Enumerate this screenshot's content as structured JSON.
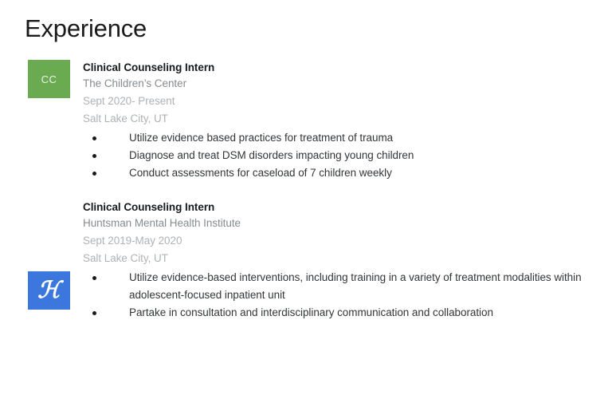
{
  "section": {
    "title": "Experience"
  },
  "colors": {
    "logo_green": "#6aab52",
    "logo_blue": "#3b77dd",
    "heading": "#1a1a1a",
    "job_title": "#16191d",
    "org_gray": "#868b8f",
    "meta_gray": "#aeb2b6",
    "bullet_text": "#333638",
    "background": "#ffffff"
  },
  "entries": [
    {
      "logo": {
        "type": "initials-badge",
        "icon_name": "childrens-center-logo",
        "text": "CC",
        "color": "#6aab52"
      },
      "title": "Clinical Counseling Intern",
      "organization": "The Children’s Center",
      "dates": "Sept 2020- Present",
      "location": "Salt Lake City, UT",
      "bullets": [
        "Utilize evidence based practices for treatment of trauma",
        "Diagnose and treat DSM disorders impacting young children",
        "Conduct assessments for caseload of 7 children weekly"
      ]
    },
    {
      "logo": {
        "type": "script-monogram",
        "icon_name": "huntsman-logo",
        "text": "ℋ",
        "color": "#3b77dd"
      },
      "title": "Clinical Counseling Intern",
      "organization": "Huntsman Mental Health Institute",
      "dates": "Sept 2019-May 2020",
      "location": "Salt Lake City, UT",
      "bullets": [
        "Utilize evidence-based interventions, including training in a variety of treatment modalities within adolescent-focused inpatient unit",
        "Partake in consultation and interdisciplinary communication and collaboration"
      ]
    }
  ]
}
